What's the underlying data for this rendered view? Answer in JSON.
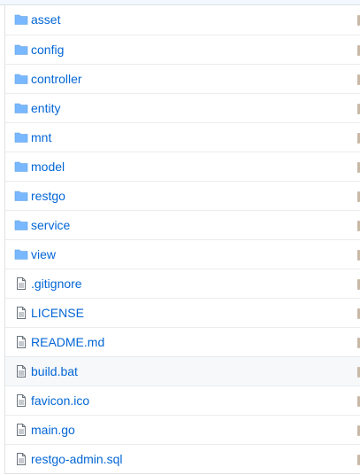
{
  "files": [
    {
      "name": "asset",
      "type": "folder",
      "icon": "folder-icon"
    },
    {
      "name": "config",
      "type": "folder",
      "icon": "folder-icon"
    },
    {
      "name": "controller",
      "type": "folder",
      "icon": "folder-icon"
    },
    {
      "name": "entity",
      "type": "folder",
      "icon": "folder-icon"
    },
    {
      "name": "mnt",
      "type": "folder",
      "icon": "folder-icon"
    },
    {
      "name": "model",
      "type": "folder",
      "icon": "folder-icon"
    },
    {
      "name": "restgo",
      "type": "folder",
      "icon": "folder-icon"
    },
    {
      "name": "service",
      "type": "folder",
      "icon": "folder-icon"
    },
    {
      "name": "view",
      "type": "folder",
      "icon": "folder-icon"
    },
    {
      "name": ".gitignore",
      "type": "file",
      "icon": "file-icon"
    },
    {
      "name": "LICENSE",
      "type": "file",
      "icon": "file-icon"
    },
    {
      "name": "README.md",
      "type": "file",
      "icon": "file-icon"
    },
    {
      "name": "build.bat",
      "type": "file",
      "icon": "file-icon",
      "hovered": true
    },
    {
      "name": "favicon.ico",
      "type": "file",
      "icon": "file-icon"
    },
    {
      "name": "main.go",
      "type": "file",
      "icon": "file-icon"
    },
    {
      "name": "restgo-admin.sql",
      "type": "file",
      "icon": "file-icon"
    }
  ],
  "colors": {
    "link": "#0366d6",
    "folder_icon": "#79b8ff",
    "file_icon": "#6a737d",
    "row_border": "#eaecef",
    "hover_row": "#f6f8fa"
  }
}
